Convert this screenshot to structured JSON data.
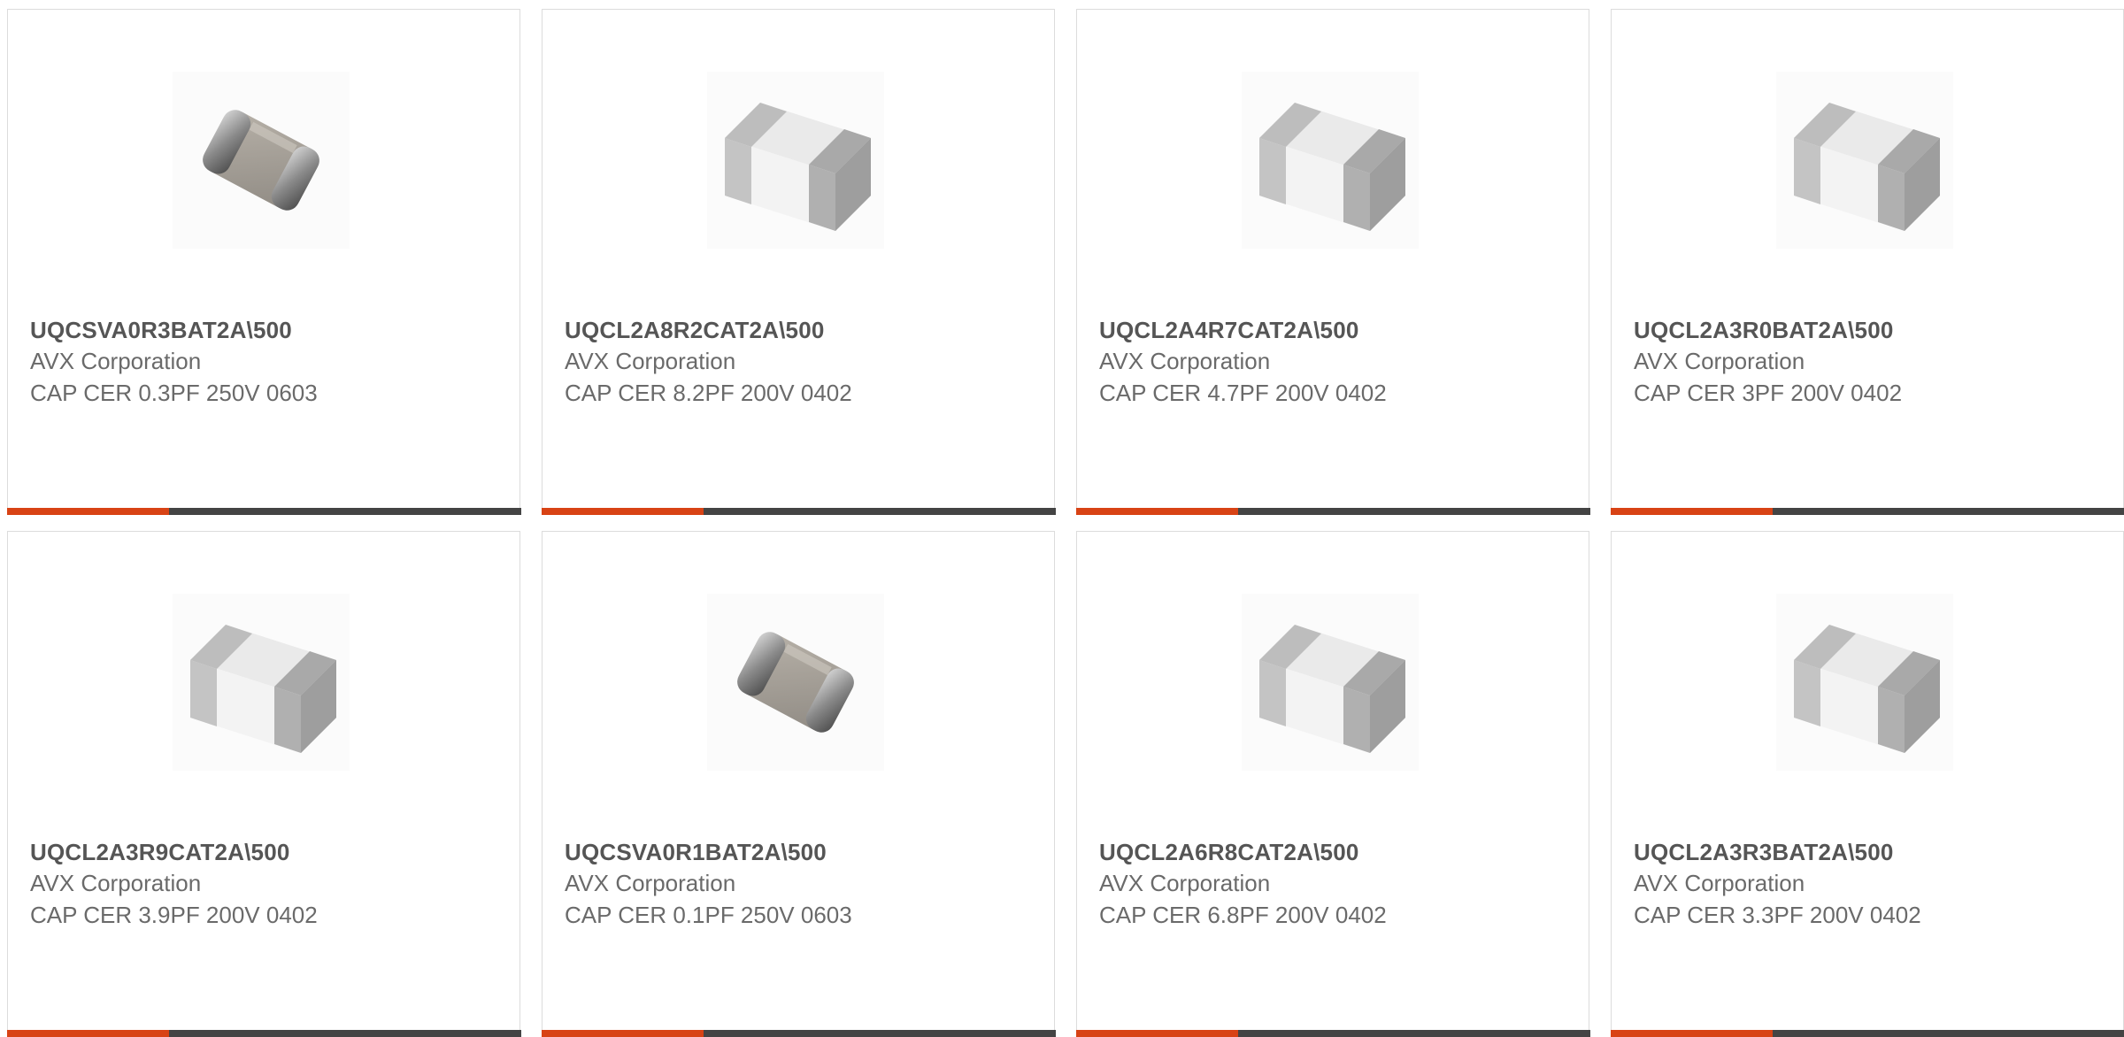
{
  "colors": {
    "accent": "#d84315",
    "bar_dark": "#444444",
    "border": "#dcdcdc",
    "title_text": "#555555",
    "body_text": "#6a6a6a"
  },
  "products": [
    {
      "part_number": "UQCSVA0R3BAT2A\\500",
      "manufacturer": "AVX Corporation",
      "description": "CAP CER 0.3PF 250V 0603",
      "image": "capacitor-0603-icon"
    },
    {
      "part_number": "UQCL2A8R2CAT2A\\500",
      "manufacturer": "AVX Corporation",
      "description": "CAP CER 8.2PF 200V 0402",
      "image": "capacitor-0402-icon"
    },
    {
      "part_number": "UQCL2A4R7CAT2A\\500",
      "manufacturer": "AVX Corporation",
      "description": "CAP CER 4.7PF 200V 0402",
      "image": "capacitor-0402-icon"
    },
    {
      "part_number": "UQCL2A3R0BAT2A\\500",
      "manufacturer": "AVX Corporation",
      "description": "CAP CER 3PF 200V 0402",
      "image": "capacitor-0402-icon"
    },
    {
      "part_number": "UQCL2A3R9CAT2A\\500",
      "manufacturer": "AVX Corporation",
      "description": "CAP CER 3.9PF 200V 0402",
      "image": "capacitor-0402-icon"
    },
    {
      "part_number": "UQCSVA0R1BAT2A\\500",
      "manufacturer": "AVX Corporation",
      "description": "CAP CER 0.1PF 250V 0603",
      "image": "capacitor-0603-icon"
    },
    {
      "part_number": "UQCL2A6R8CAT2A\\500",
      "manufacturer": "AVX Corporation",
      "description": "CAP CER 6.8PF 200V 0402",
      "image": "capacitor-0402-icon"
    },
    {
      "part_number": "UQCL2A3R3BAT2A\\500",
      "manufacturer": "AVX Corporation",
      "description": "CAP CER 3.3PF 200V 0402",
      "image": "capacitor-0402-icon"
    }
  ]
}
